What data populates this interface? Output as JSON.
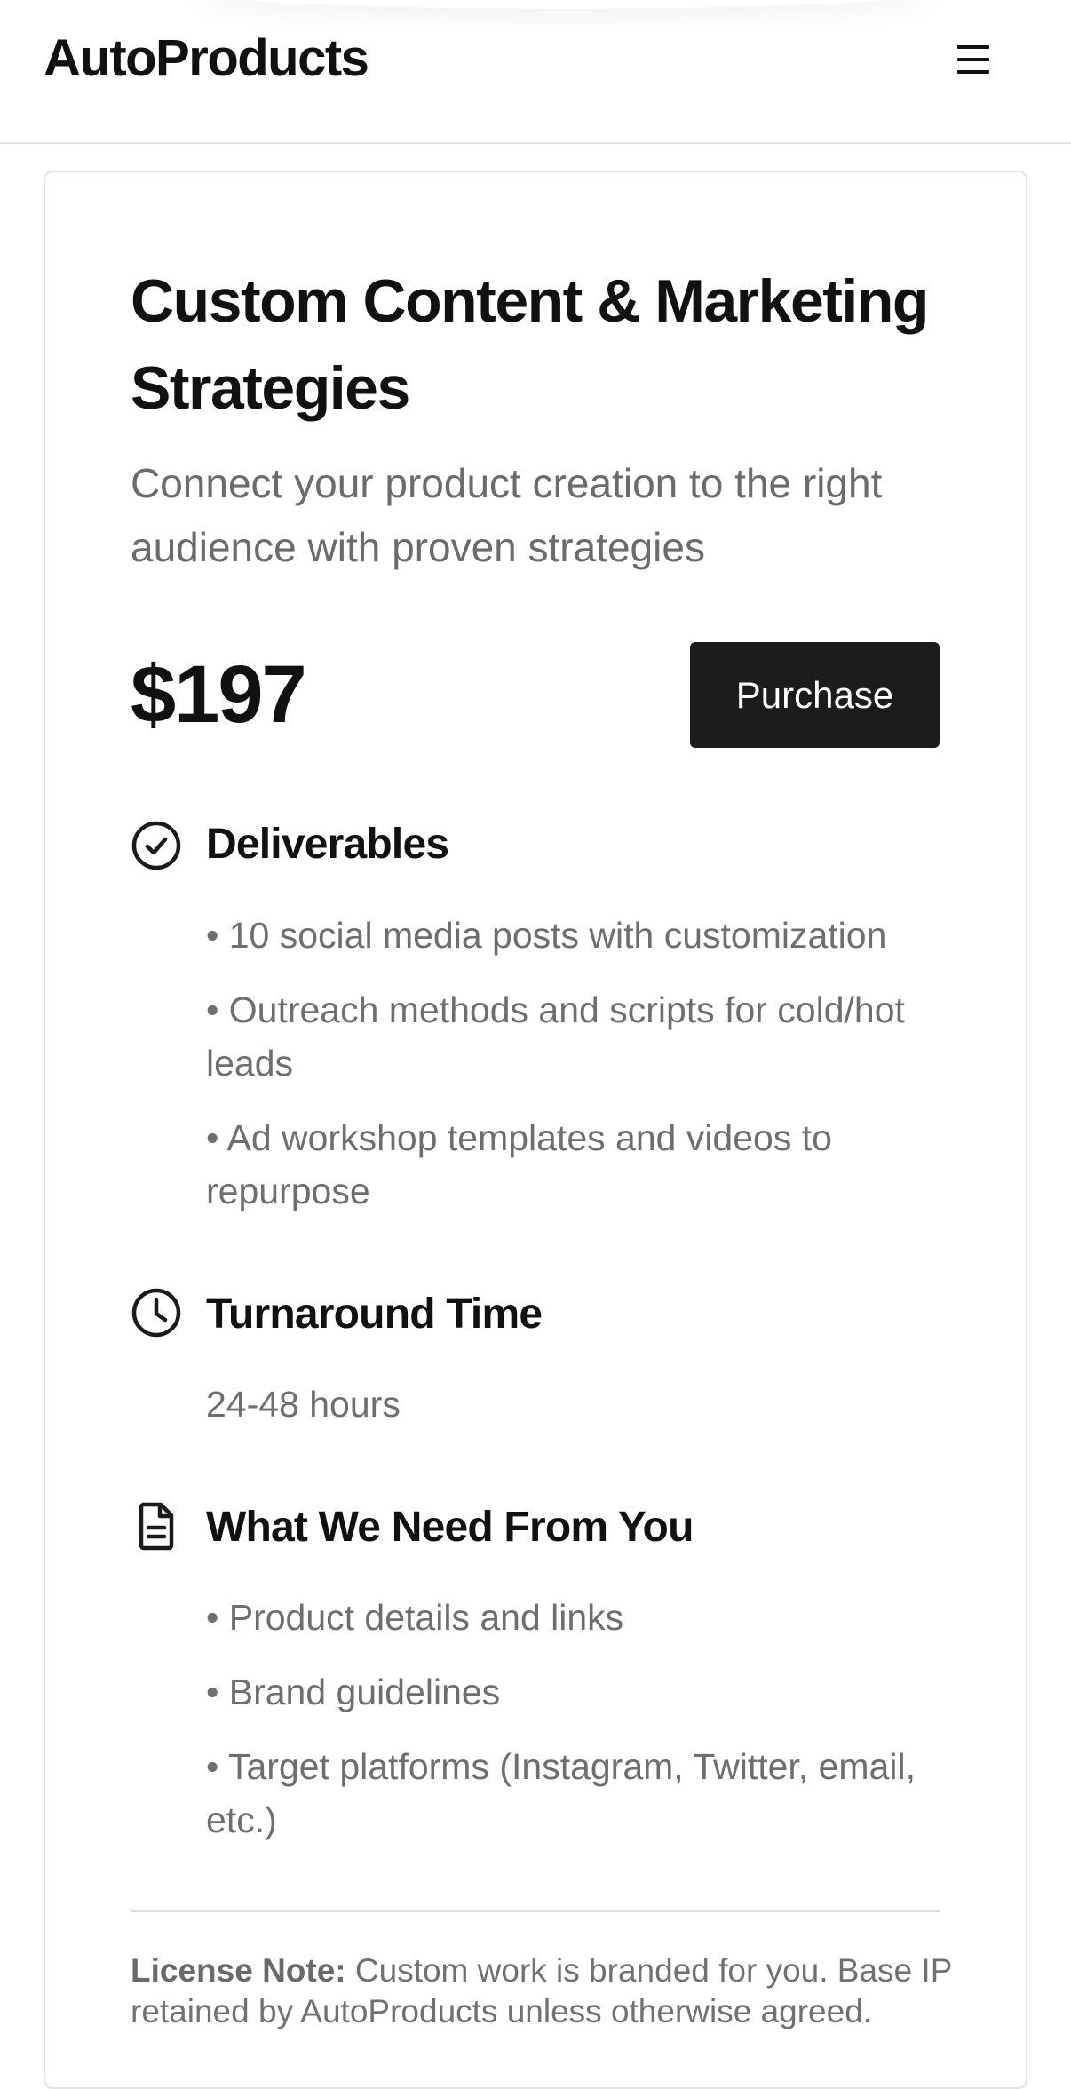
{
  "header": {
    "brand": "AutoProducts",
    "menu_icon": "hamburger-menu-icon"
  },
  "product": {
    "title": "Custom Content & Marketing Strategies",
    "subtitle": "Connect your product creation to the right audience with proven strategies",
    "price": "$197",
    "purchase_label": "Purchase"
  },
  "sections": {
    "deliverables": {
      "icon": "check-circle-icon",
      "heading": "Deliverables",
      "items": [
        "• 10 social media posts with customization",
        "• Outreach methods and scripts for cold/hot leads",
        "• Ad workshop templates and videos to repurpose"
      ]
    },
    "turnaround": {
      "icon": "clock-icon",
      "heading": "Turnaround Time",
      "value": "24-48 hours"
    },
    "requirements": {
      "icon": "document-icon",
      "heading": "What We Need From You",
      "items": [
        "• Product details and links",
        "• Brand guidelines",
        "• Target platforms (Instagram, Twitter, email, etc.)"
      ]
    }
  },
  "license": {
    "label": "License Note:",
    "text": " Custom work is branded for you. Base IP retained by AutoProducts unless otherwise agreed."
  },
  "colors": {
    "primary_text": "#111111",
    "muted_text": "#6e6e6e",
    "button_bg": "#1c1c1c",
    "border": "#e3e3e3"
  }
}
